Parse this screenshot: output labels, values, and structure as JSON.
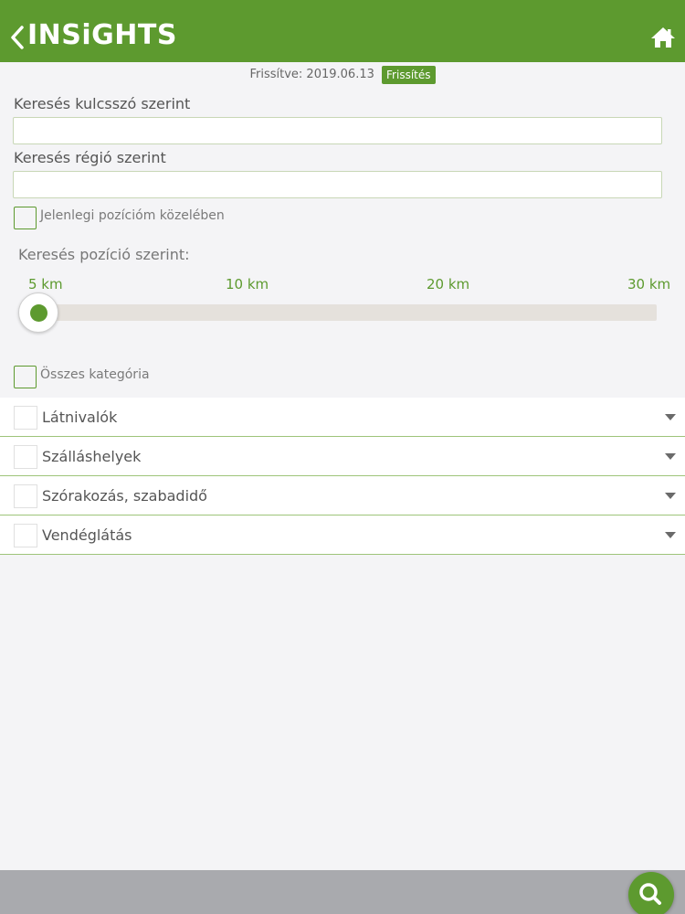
{
  "header": {
    "title": "INSiGHTS",
    "back_icon": "chevron-left-icon",
    "home_icon": "home-icon",
    "color": "#5d9a2f"
  },
  "update": {
    "text": "Frissítve: 2019.06.13",
    "refresh_label": "Frissítés"
  },
  "search": {
    "keyword_label": "Keresés kulcsszó szerint",
    "keyword_value": "",
    "region_label": "Keresés régió szerint",
    "region_value": ""
  },
  "nearby": {
    "label": "Jelenlegi pozícióm közelében",
    "checked": false
  },
  "distance": {
    "title": "Keresés pozíció szerint:",
    "ticks": [
      "5 km",
      "10 km",
      "20 km",
      "30 km"
    ],
    "selected": "5 km"
  },
  "all_categories": {
    "label": "Összes kategória",
    "checked": false
  },
  "categories": [
    {
      "label": "Látnivalók"
    },
    {
      "label": "Szálláshelyek"
    },
    {
      "label": "Szórakozás, szabadidő"
    },
    {
      "label": "Vendéglátás"
    }
  ],
  "footer": {
    "search_icon": "search-icon"
  }
}
